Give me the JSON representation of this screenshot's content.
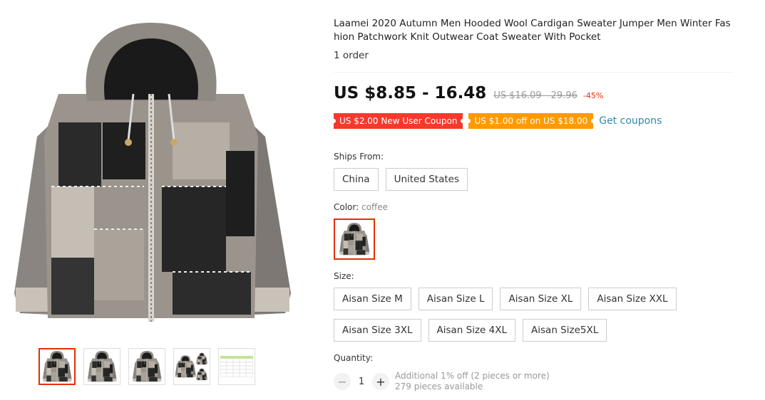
{
  "product": {
    "title": "Laamei 2020 Autumn Men Hooded Wool Cardigan Sweater Jumper Men Winter Fashion Patchwork Knit Outwear Coat Sweater With Pocket",
    "orders": "1 order"
  },
  "price": {
    "current": "US $8.85 - 16.48",
    "original": "US $16.09 - 29.96",
    "discount": "-45%"
  },
  "coupons": {
    "new_user": "US $2.00 New User Coupon",
    "store": "US $1.00 off on US $18.00",
    "get_label": "Get coupons"
  },
  "ships_from": {
    "label": "Ships From:",
    "options": [
      "China",
      "United States"
    ]
  },
  "color": {
    "label": "Color:",
    "selected": "coffee"
  },
  "size": {
    "label": "Size:",
    "options": [
      "Aisan Size M",
      "Aisan Size L",
      "Aisan Size XL",
      "Aisan Size XXL",
      "Aisan Size 3XL",
      "Aisan Size 4XL",
      "Aisan Size5XL"
    ]
  },
  "quantity": {
    "label": "Quantity:",
    "value": "1",
    "minus": "−",
    "plus": "+",
    "discount_note": "Additional 1% off (2 pieces or more)",
    "available": "279 pieces available"
  },
  "colors": {
    "accent": "#e62e04",
    "coupon_red": "#f5392c",
    "coupon_orange": "#ff9a00",
    "link": "#2e8aae"
  }
}
